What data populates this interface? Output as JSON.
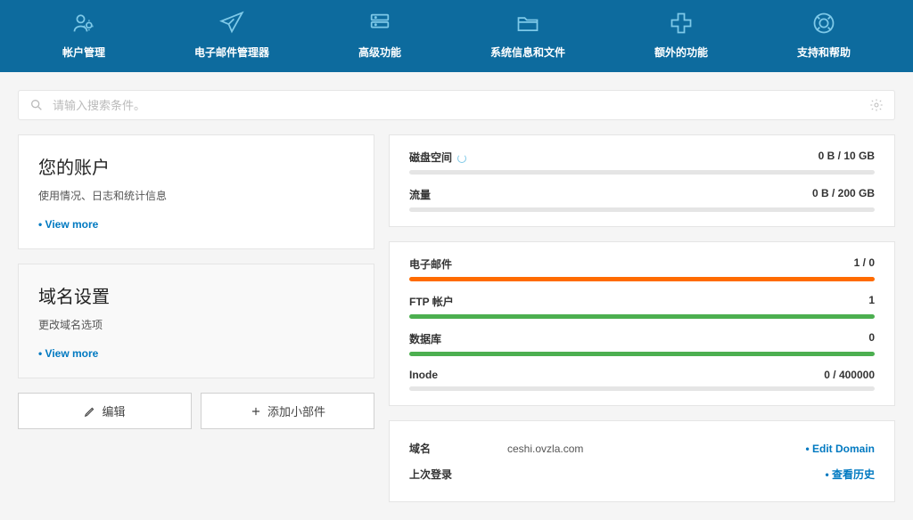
{
  "nav": {
    "items": [
      {
        "label": "帐户管理",
        "icon": "users"
      },
      {
        "label": "电子邮件管理器",
        "icon": "plane"
      },
      {
        "label": "高级功能",
        "icon": "server"
      },
      {
        "label": "系统信息和文件",
        "icon": "folder"
      },
      {
        "label": "额外的功能",
        "icon": "plus"
      },
      {
        "label": "支持和帮助",
        "icon": "lifebuoy"
      }
    ]
  },
  "search": {
    "placeholder": "请输入搜索条件。"
  },
  "panels": {
    "account": {
      "title": "您的账户",
      "desc": "使用情况、日志和统计信息",
      "more": "View more"
    },
    "domain": {
      "title": "域名设置",
      "desc": "更改域名选项",
      "more": "View more"
    }
  },
  "buttons": {
    "edit": "编辑",
    "addwidget": "添加小部件"
  },
  "usage": {
    "disk": {
      "label": "磁盘空间",
      "value": "0 B / 10 GB",
      "pct": 0
    },
    "bw": {
      "label": "流量",
      "value": "0 B / 200 GB",
      "pct": 0
    }
  },
  "resources": {
    "email": {
      "label": "电子邮件",
      "value": "1 / 0",
      "pct": 100,
      "color": "orange"
    },
    "ftp": {
      "label": "FTP 帐户",
      "value": "1",
      "pct": 100,
      "color": "green"
    },
    "db": {
      "label": "数据库",
      "value": "0",
      "pct": 100,
      "color": "green"
    },
    "inode": {
      "label": "Inode",
      "value": "0 / 400000",
      "pct": 0,
      "color": "gray"
    }
  },
  "domaininfo": {
    "domain": {
      "label": "域名",
      "value": "ceshi.ovzla.com",
      "link": "Edit Domain"
    },
    "lastlogin": {
      "label": "上次登录",
      "value": "",
      "link": "查看历史"
    }
  }
}
